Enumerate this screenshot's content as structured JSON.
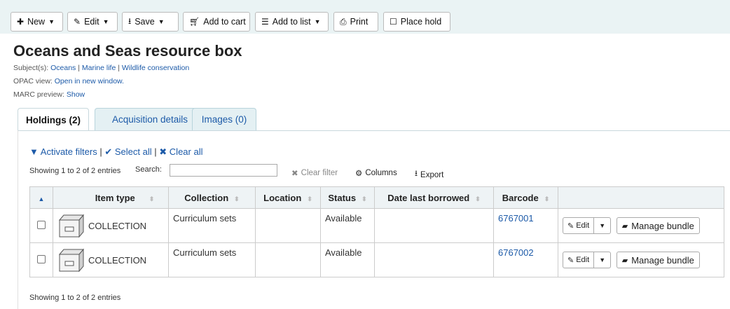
{
  "toolbar": {
    "new_label": "New",
    "edit_label": "Edit",
    "save_label": "Save",
    "add_to_cart_label": "Add to cart",
    "add_to_list_label": "Add to list",
    "print_label": "Print",
    "place_hold_label": "Place hold"
  },
  "record": {
    "title": "Oceans and Seas resource box",
    "subjects_label": "Subject(s):",
    "subjects": [
      "Oceans",
      "Marine life",
      "Wildlife conservation"
    ],
    "subject_sep": "|",
    "opac_label": "OPAC view:",
    "opac_link": "Open in new window.",
    "marc_label": "MARC preview:",
    "marc_link": "Show"
  },
  "tabs": [
    {
      "label": "Holdings (2)",
      "active": true
    },
    {
      "label": "Acquisition details",
      "active": false
    },
    {
      "label": "Images (0)",
      "active": false
    }
  ],
  "holdings": {
    "activate_filters": "Activate filters",
    "select_all": "Select all",
    "clear_all": "Clear all",
    "sep": "|",
    "showing_top": "Showing 1 to 2 of 2 entries",
    "showing_bottom": "Showing 1 to 2 of 2 entries",
    "search_label": "Search:",
    "search_value": "",
    "clear_filter": "Clear filter",
    "columns": "Columns",
    "export": "Export",
    "headers": [
      "Item type",
      "Collection",
      "Location",
      "Status",
      "Date last borrowed",
      "Barcode"
    ],
    "rows": [
      {
        "item_type": "COLLECTION",
        "collection": "Curriculum sets",
        "location": "",
        "status": "Available",
        "date_last_borrowed": "",
        "barcode": "6767001"
      },
      {
        "item_type": "COLLECTION",
        "collection": "Curriculum sets",
        "location": "",
        "status": "Available",
        "date_last_borrowed": "",
        "barcode": "6767002"
      }
    ],
    "edit_label": "Edit",
    "manage_bundle_label": "Manage bundle"
  },
  "colors": {
    "link": "#1c5aa8",
    "toolbar_bg": "#eaf3f4",
    "header_bg": "#eef3f5"
  },
  "icons": [
    "plus-icon",
    "pencil-icon",
    "download-icon",
    "cart-icon",
    "list-icon",
    "print-icon",
    "square-icon",
    "filter-icon",
    "check-icon",
    "times-icon",
    "gear-icon",
    "folder-icon",
    "caret-down-icon",
    "sort-icon",
    "box-icon"
  ]
}
